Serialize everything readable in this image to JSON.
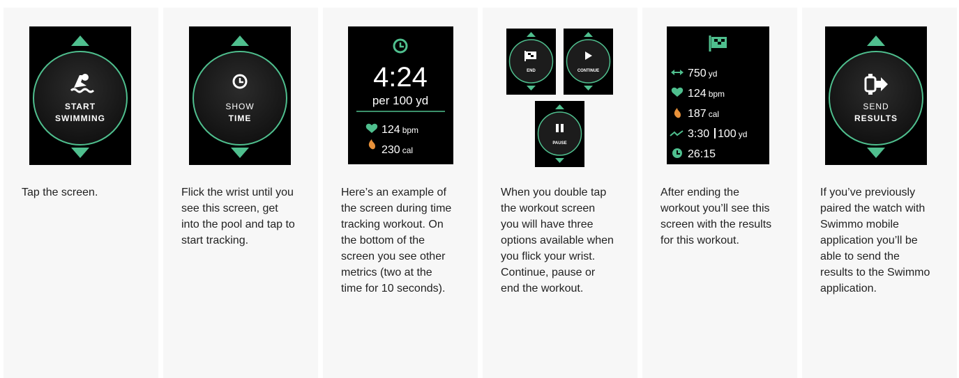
{
  "steps": [
    {
      "description": "Tap the screen.",
      "screen": {
        "type": "button",
        "icon": "swimmer-icon",
        "line1": "START",
        "line2": "SWIMMING"
      }
    },
    {
      "description": "Flick the wrist until you see this screen, get into the pool and tap to start tracking.",
      "screen": {
        "type": "button",
        "icon": "clock-icon",
        "line1": "SHOW",
        "line2": "TIME"
      }
    },
    {
      "description": "Here’s an example of the screen during time tracking workout. On the bottom of the screen you see other metrics (two at the time for 10 seconds).",
      "screen": {
        "type": "workout",
        "icon": "clock-icon",
        "time": "4:24",
        "pace_unit": "per 100 yd",
        "metrics": [
          {
            "icon": "heart-rate-icon",
            "value": "124",
            "unit": "bpm"
          },
          {
            "icon": "flame-icon",
            "value": "230",
            "unit": "cal"
          }
        ]
      }
    },
    {
      "description": "When you double tap the workout screen you will have three options available when you flick your wrist. Continue, pause or end the workout.",
      "screen": {
        "type": "options",
        "options": [
          {
            "icon": "checkered-flag-icon",
            "label": "END"
          },
          {
            "icon": "play-icon",
            "label": "CONTINUE"
          },
          {
            "icon": "pause-icon",
            "label": "PAUSE"
          }
        ]
      }
    },
    {
      "description": "After ending the workout you’ll see this screen with the results for this workout.",
      "screen": {
        "type": "results",
        "icon": "checkered-flag-icon",
        "rows": [
          {
            "icon": "distance-icon",
            "value": "750",
            "unit": "yd"
          },
          {
            "icon": "heart-rate-icon",
            "value": "124",
            "unit": "bpm"
          },
          {
            "icon": "flame-icon",
            "value": "187",
            "unit": "cal"
          },
          {
            "icon": "pace-icon",
            "value": "3:30",
            "value2": "100",
            "unit": "yd"
          },
          {
            "icon": "clock-icon",
            "value": "26:15",
            "unit": ""
          }
        ]
      }
    },
    {
      "description": "If you’ve previously paired the watch with Swimmo mobile application you’ll be able to send the results to the Swimmo application.",
      "screen": {
        "type": "button",
        "icon": "send-watch-icon",
        "line1": "SEND",
        "line2": "RESULTS"
      }
    }
  ],
  "colors": {
    "accent": "#4fbf8e",
    "screen_bg": "#000000",
    "panel_bg": "#f7f7f7",
    "text": "#222222"
  }
}
